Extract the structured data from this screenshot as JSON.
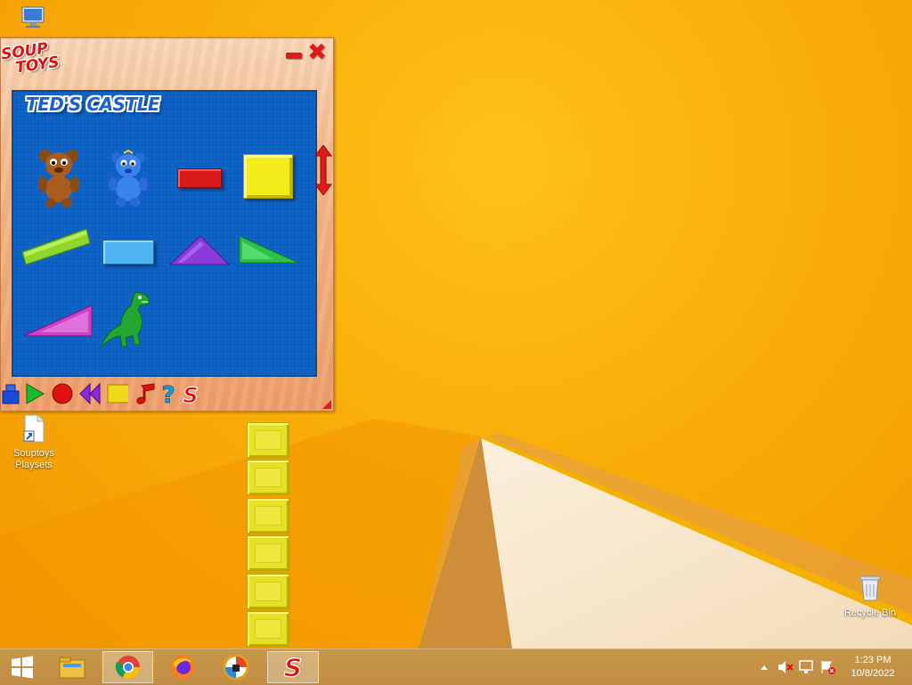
{
  "desktop": {
    "icons": [
      {
        "name": "computer",
        "label": ""
      },
      {
        "name": "souptoys-playsets",
        "label": "Souptoys Playsets"
      },
      {
        "name": "recycle-bin",
        "label": "Recycle Bin"
      }
    ]
  },
  "app": {
    "logo_line1": "SOUP",
    "logo_line2": "TOYS",
    "playset_title": "TED'S CASTLE",
    "toys": [
      "brown-teddy-bear",
      "blue-teddy-bear",
      "red-brick",
      "yellow-block",
      "green-long-block",
      "blue-brick",
      "purple-triangle",
      "green-triangle",
      "magenta-triangle",
      "green-dinosaur"
    ],
    "toolbar": [
      "toy-box-icon",
      "play-icon",
      "record-icon",
      "rewind-icon",
      "stop-icon",
      "music-icon",
      "help-icon",
      "souptoys-icon"
    ],
    "colors": {
      "canvas": "#0c60c4",
      "frame": "#f3b98a",
      "accent": "#e11a1a"
    }
  },
  "taskbar": {
    "apps": [
      "start-icon",
      "file-explorer-icon",
      "chrome-icon",
      "firefox-icon",
      "vpn-icon",
      "souptoys-icon"
    ],
    "active_app": "chrome-icon",
    "clock_time": "1:23 PM",
    "clock_date": "10/8/2022"
  }
}
